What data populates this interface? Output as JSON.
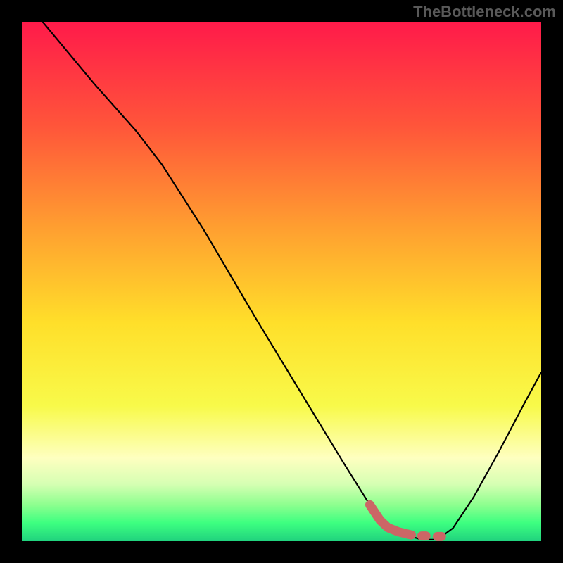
{
  "watermark": "TheBottleneck.com",
  "chart_data": {
    "type": "line",
    "title": "",
    "xlabel": "",
    "ylabel": "",
    "xlim": [
      0,
      100
    ],
    "ylim": [
      0,
      100
    ],
    "gradient_stops": [
      {
        "offset": 0,
        "color": "#ff1a4a"
      },
      {
        "offset": 20,
        "color": "#ff553a"
      },
      {
        "offset": 40,
        "color": "#ffa030"
      },
      {
        "offset": 58,
        "color": "#ffdf2a"
      },
      {
        "offset": 74,
        "color": "#f8fa4a"
      },
      {
        "offset": 84,
        "color": "#feffc0"
      },
      {
        "offset": 89,
        "color": "#d6ffb3"
      },
      {
        "offset": 93,
        "color": "#8dff8f"
      },
      {
        "offset": 96.5,
        "color": "#3dff80"
      },
      {
        "offset": 100,
        "color": "#20d27e"
      }
    ],
    "series": [
      {
        "name": "bottleneck-curve",
        "color": "#000000",
        "width": 2.2,
        "points": [
          {
            "x": 4.0,
            "y": 100.0
          },
          {
            "x": 14.0,
            "y": 88.0
          },
          {
            "x": 22.0,
            "y": 79.0
          },
          {
            "x": 27.0,
            "y": 72.5
          },
          {
            "x": 35.0,
            "y": 60.0
          },
          {
            "x": 45.0,
            "y": 43.0
          },
          {
            "x": 55.0,
            "y": 26.5
          },
          {
            "x": 62.0,
            "y": 15.0
          },
          {
            "x": 67.0,
            "y": 7.0
          },
          {
            "x": 70.0,
            "y": 3.5
          },
          {
            "x": 73.0,
            "y": 1.5
          },
          {
            "x": 77.0,
            "y": 0.3
          },
          {
            "x": 80.0,
            "y": 0.3
          },
          {
            "x": 83.0,
            "y": 2.5
          },
          {
            "x": 87.0,
            "y": 8.5
          },
          {
            "x": 92.0,
            "y": 17.5
          },
          {
            "x": 97.0,
            "y": 27.0
          },
          {
            "x": 100.0,
            "y": 32.5
          }
        ]
      },
      {
        "name": "highlight-segment",
        "color": "#cc6666",
        "width": 13,
        "linecap": "round",
        "points": [
          {
            "x": 67.0,
            "y": 7.0
          },
          {
            "x": 69.0,
            "y": 4.0
          },
          {
            "x": 70.5,
            "y": 2.6
          },
          {
            "x": 72.5,
            "y": 1.8
          },
          {
            "x": 75.0,
            "y": 1.2
          }
        ]
      },
      {
        "name": "highlight-dot-1",
        "color": "#cc6666",
        "width": 13,
        "linecap": "round",
        "points": [
          {
            "x": 77.0,
            "y": 1.0
          },
          {
            "x": 77.8,
            "y": 1.0
          }
        ]
      },
      {
        "name": "highlight-dot-2",
        "color": "#cc6666",
        "width": 13,
        "linecap": "round",
        "points": [
          {
            "x": 80.0,
            "y": 0.9
          },
          {
            "x": 80.8,
            "y": 0.9
          }
        ]
      }
    ]
  }
}
